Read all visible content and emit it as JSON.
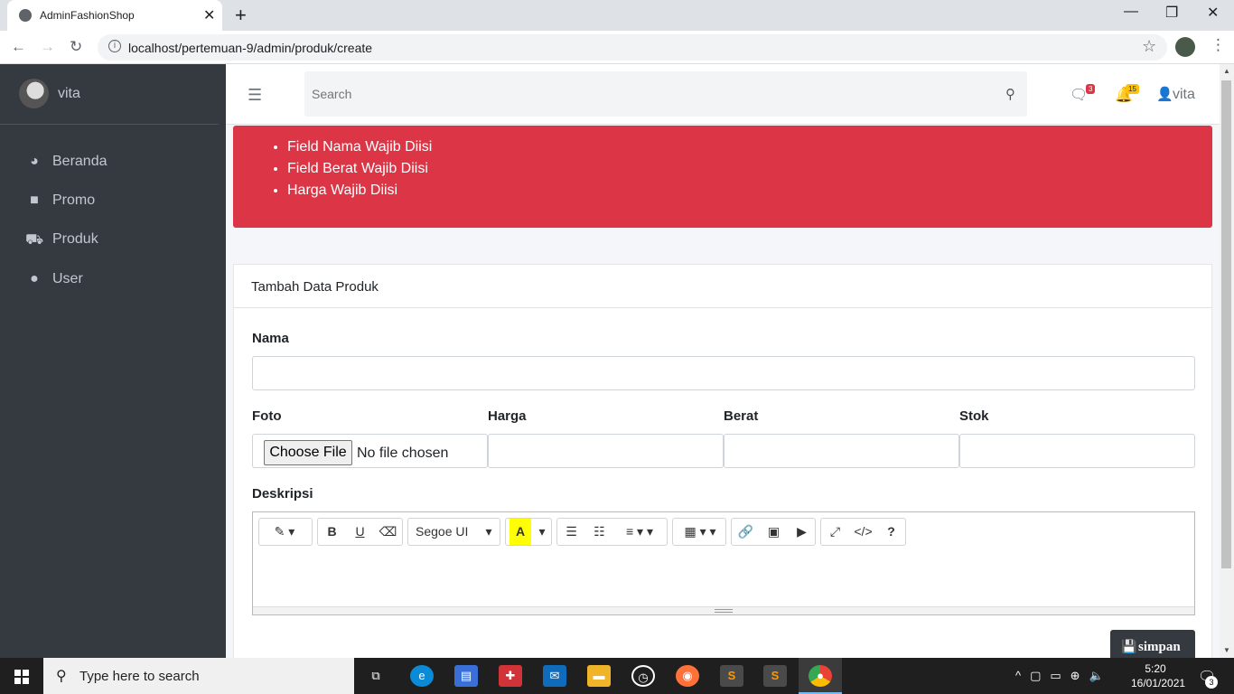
{
  "browser": {
    "tab_title": "AdminFashionShop",
    "url": "localhost/pertemuan-9/admin/produk/create"
  },
  "sidebar": {
    "user_name": "vita",
    "items": [
      {
        "label": "Beranda",
        "icon": "tachometer-icon"
      },
      {
        "label": "Promo",
        "icon": "shopping-bag-icon"
      },
      {
        "label": "Produk",
        "icon": "shopping-cart-icon"
      },
      {
        "label": "User",
        "icon": "user-icon"
      }
    ]
  },
  "navbar": {
    "search_placeholder": "Search",
    "messages_count": "3",
    "notifications_count": "15",
    "user_name": "vita"
  },
  "alert": {
    "color": "#dc3545",
    "errors": [
      "Field Nama Wajib Diisi",
      "Field Berat Wajib Diisi",
      "Harga Wajib Diisi"
    ]
  },
  "form": {
    "card_title": "Tambah Data Produk",
    "nama_label": "Nama",
    "nama_value": "",
    "foto_label": "Foto",
    "file_button": "Choose File",
    "file_status": "No file chosen",
    "harga_label": "Harga",
    "harga_value": "",
    "berat_label": "Berat",
    "berat_value": "",
    "stok_label": "Stok",
    "stok_value": "",
    "deskripsi_label": "Deskripsi",
    "editor_font": "Segoe UI",
    "submit_label": "simpan"
  },
  "taskbar": {
    "search_text": "Type here to search",
    "time": "5:20",
    "date": "16/01/2021",
    "notification_count": "3"
  }
}
